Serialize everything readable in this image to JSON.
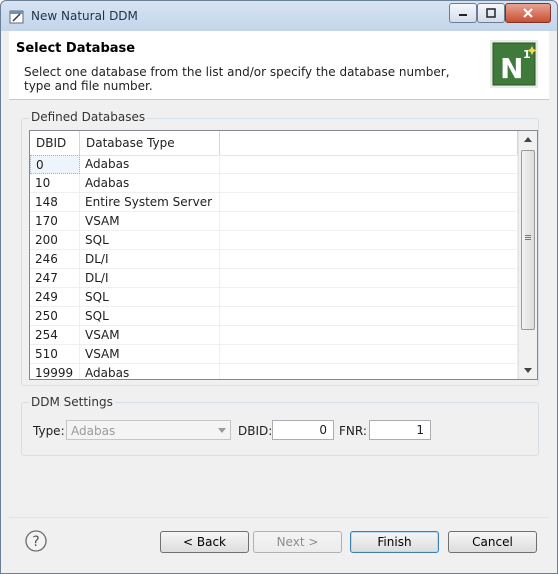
{
  "window": {
    "title": "New Natural DDM"
  },
  "header": {
    "title": "Select Database",
    "description": "Select one database from the list and/or specify the database number, type and file number.",
    "logo_text": "N",
    "logo_sup": "1"
  },
  "defined_databases": {
    "group_label": "Defined Databases",
    "columns": [
      "DBID",
      "Database Type"
    ],
    "rows": [
      {
        "dbid": "0",
        "type": "Adabas"
      },
      {
        "dbid": "10",
        "type": "Adabas"
      },
      {
        "dbid": "148",
        "type": "Entire System Server"
      },
      {
        "dbid": "170",
        "type": "VSAM"
      },
      {
        "dbid": "200",
        "type": "SQL"
      },
      {
        "dbid": "246",
        "type": "DL/I"
      },
      {
        "dbid": "247",
        "type": "DL/I"
      },
      {
        "dbid": "249",
        "type": "SQL"
      },
      {
        "dbid": "250",
        "type": "SQL"
      },
      {
        "dbid": "254",
        "type": "VSAM"
      },
      {
        "dbid": "510",
        "type": "VSAM"
      },
      {
        "dbid": "19999",
        "type": "Adabas"
      }
    ],
    "selected_row": 0
  },
  "ddm_settings": {
    "group_label": "DDM Settings",
    "type_label": "Type:",
    "type_value": "Adabas",
    "dbid_label": "DBID:",
    "dbid_value": "0",
    "fnr_label": "FNR:",
    "fnr_value": "1"
  },
  "buttons": {
    "back": "< Back",
    "next": "Next >",
    "finish": "Finish",
    "cancel": "Cancel"
  },
  "colors": {
    "accent": "#3c7fb1",
    "logo_green": "#3f7a3a"
  }
}
